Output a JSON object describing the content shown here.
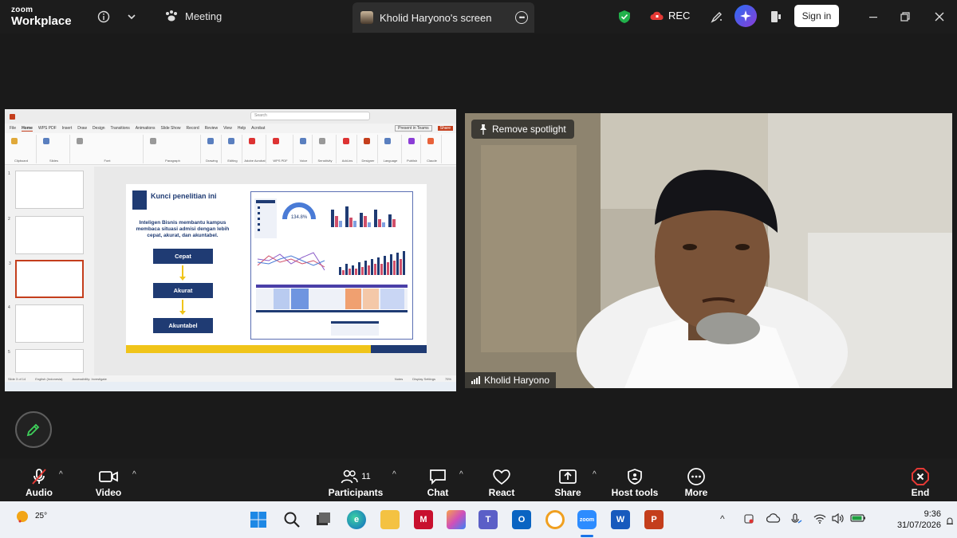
{
  "app": {
    "logo_top": "zoom",
    "logo_bottom": "Workplace"
  },
  "header": {
    "meeting_label": "Meeting",
    "screen_share_label": "Kholid Haryono's screen",
    "rec_label": "REC",
    "sign_in_label": "Sign in"
  },
  "shared_screen": {
    "search_placeholder": "Search",
    "tabs": [
      "File",
      "Home",
      "WPS PDF",
      "Insert",
      "Draw",
      "Design",
      "Transitions",
      "Animations",
      "Slide Show",
      "Record",
      "Review",
      "View",
      "Help",
      "Acrobat"
    ],
    "present_label": "Present in Teams",
    "share_label": "Share",
    "ribbon_groups": [
      "Clipboard",
      "Slides",
      "Font",
      "Paragraph",
      "Drawing",
      "Editing",
      "Adobe Acrobat",
      "WPS PDF",
      "Voice",
      "Sensitivity",
      "Add-ins",
      "Designer",
      "Language",
      "Publish",
      "Claude"
    ],
    "slide": {
      "title": "Kunci penelitian ini",
      "description": "Inteligen Bisnis membantu kampus membaca situasi admisi dengan lebih cepat, akurat, dan akuntabel.",
      "boxes": [
        "Cepat",
        "Akurat",
        "Akuntabel"
      ],
      "gauge_value": "134.8%"
    },
    "status": {
      "slide_count": "Slide 3 of 14",
      "language": "English (Indonesia)",
      "accessibility": "Accessibility: Investigate",
      "notes": "Notes",
      "display": "Display Settings",
      "zoom": "75%"
    }
  },
  "video": {
    "remove_spotlight_label": "Remove spotlight",
    "participant_name": "Kholid Haryono"
  },
  "toolbar": {
    "audio": "Audio",
    "video": "Video",
    "participants": "Participants",
    "participants_count": "11",
    "chat": "Chat",
    "react": "React",
    "share": "Share",
    "host_tools": "Host tools",
    "more": "More",
    "end": "End"
  },
  "taskbar": {
    "temperature": "25°",
    "time": "9:36",
    "date": "31/07/2026",
    "apps": [
      "windows",
      "search",
      "task-view",
      "edge",
      "file-explorer",
      "mcafee",
      "copilot",
      "teams",
      "outlook",
      "vpn",
      "zoom",
      "word",
      "powerpoint"
    ]
  },
  "colors": {
    "accent_blue": "#1f3b73",
    "accent_yellow": "#f0c419",
    "end_red": "#e53935",
    "ai_gradient": "#2a6df4"
  }
}
